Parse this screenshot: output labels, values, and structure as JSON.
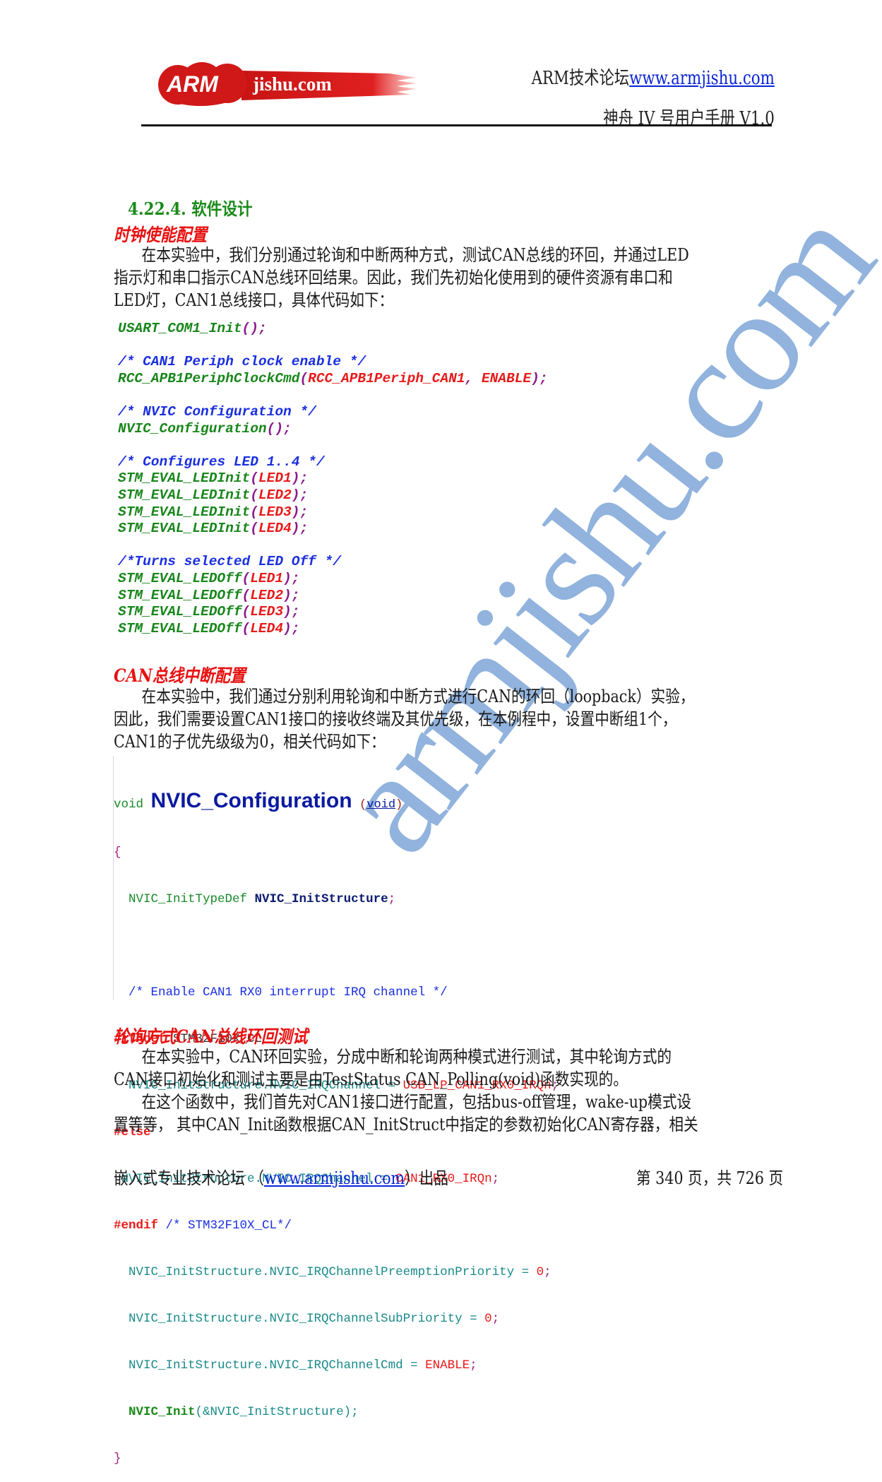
{
  "header": {
    "logo_text_arm": "ARM",
    "logo_text_site": "jishu.com",
    "forum_label": "ARM技术论坛",
    "forum_url": "www.armjishu.com",
    "manual_title": "神舟 IV 号用户手册  V1.0",
    "brand_color": "#d81e1e"
  },
  "section": {
    "heading": "4.22.4. 软件设计",
    "clock": {
      "title": "时钟使能配置",
      "paragraph": [
        "在本实验中，我们分别通过轮询和中断两种方式，测试CAN总线的环回，并通过LED",
        "指示灯和串口指示CAN总线环回结果。因此，我们先初始化使用到的硬件资源有串口和",
        "LED灯，CAN1总线接口，具体代码如下："
      ]
    },
    "code1": [
      {
        "fn": "USART_COM1_Init",
        "open": "(",
        "args": "",
        "close": ");"
      },
      {
        "blank": true
      },
      {
        "comment": "/* CAN1 Periph clock enable */"
      },
      {
        "fn": "RCC_APB1PeriphClockCmd",
        "open": "(",
        "args": "RCC_APB1Periph_CAN1, ENABLE",
        "close": ");"
      },
      {
        "blank": true
      },
      {
        "comment": "/* NVIC Configuration */"
      },
      {
        "fn": "NVIC_Configuration",
        "open": "(",
        "args": "",
        "close": ");"
      },
      {
        "blank": true
      },
      {
        "comment": "/* Configures LED 1..4 */"
      },
      {
        "fn": "STM_EVAL_LEDInit",
        "open": "(",
        "args": "LED1",
        "close": ");"
      },
      {
        "fn": "STM_EVAL_LEDInit",
        "open": "(",
        "args": "LED2",
        "close": ");"
      },
      {
        "fn": "STM_EVAL_LEDInit",
        "open": "(",
        "args": "LED3",
        "close": ");"
      },
      {
        "fn": "STM_EVAL_LEDInit",
        "open": "(",
        "args": "LED4",
        "close": ");"
      },
      {
        "blank": true
      },
      {
        "comment": "/*Turns selected LED Off */"
      },
      {
        "fn": "STM_EVAL_LEDOff",
        "open": "(",
        "args": "LED1",
        "close": ");"
      },
      {
        "fn": "STM_EVAL_LEDOff",
        "open": "(",
        "args": "LED2",
        "close": ");"
      },
      {
        "fn": "STM_EVAL_LEDOff",
        "open": "(",
        "args": "LED3",
        "close": ");"
      },
      {
        "fn": "STM_EVAL_LEDOff",
        "open": "(",
        "args": "LED4",
        "close": ");"
      }
    ],
    "interrupt": {
      "title": "CAN总线中断配置",
      "paragraph": [
        "在本实验中，我们通过分别利用轮询和中断方式进行CAN的环回（loopback）实验，",
        "因此，我们需要设置CAN1接口的接收终端及其优先级，在本例程中，设置中断组1个，",
        "CAN1的子优先级级为0，相关代码如下："
      ]
    },
    "code2": {
      "sig_void": "void",
      "sig_name": "NVIC_Configuration",
      "sig_open": "(",
      "sig_arg": "void",
      "sig_close": ")",
      "open_brace": "{",
      "decl_type": "  NVIC_InitTypeDef ",
      "decl_var": "NVIC_InitStructure",
      "decl_end": ";",
      "comment": "  /* Enable CAN1 RX0 interrupt IRQ channel */",
      "ifndef_kw": "#ifndef",
      "ifndef_macro": " STM32F10X_CL",
      "assign1_member": "  NVIC_InitStructure.NVIC_IRQChannel = ",
      "assign1_val": "USB_LP_CAN1_RX0_IRQn",
      "assign1_end": ";",
      "else_kw": "#else",
      "assign2_member": " NVIC_InitStructure.NVIC_IRQChannel = ",
      "assign2_val": "CAN1_RX0_IRQn",
      "assign2_end": ";",
      "endif_kw": "#endif",
      "endif_comment": " /* STM32F10X_CL*/",
      "assign3_member": "  NVIC_InitStructure.NVIC_IRQChannelPreemptionPriority = ",
      "assign3_val": "0",
      "assign3_end": ";",
      "assign4_member": "  NVIC_InitStructure.NVIC_IRQChannelSubPriority = ",
      "assign4_val": "0",
      "assign4_end": ";",
      "assign5_member": "  NVIC_InitStructure.NVIC_IRQChannelCmd = ",
      "assign5_val": "ENABLE",
      "assign5_end": ";",
      "call_indent": "  ",
      "call_fn": "NVIC_Init",
      "call_args": "(&NVIC_InitStructure);",
      "close_brace": "}"
    },
    "polling": {
      "title": "轮询方式CAN总线环回测试",
      "paragraph1": [
        "在本实验中，CAN环回实验，分成中断和轮询两种模式进行测试，其中轮询方式的",
        "CAN接口初始化和测试主要是由TestStatus CAN_Polling(void)函数实现的。"
      ],
      "paragraph2": [
        "在这个函数中，我们首先对CAN1接口进行配置，包括bus-off管理，wake-up模式设",
        "置等等， 其中CAN_Init函数根据CAN_InitStruct中指定的参数初始化CAN寄存器，相关"
      ]
    }
  },
  "watermark": {
    "text": "armjishu.com"
  },
  "footer": {
    "left_prefix": "嵌入式专业技术论坛 （",
    "left_url": "www.armjishu.com",
    "left_suffix": "）出品",
    "page_label": "第 340 页，共 726 页",
    "current_page": 340,
    "total_pages": 726
  }
}
